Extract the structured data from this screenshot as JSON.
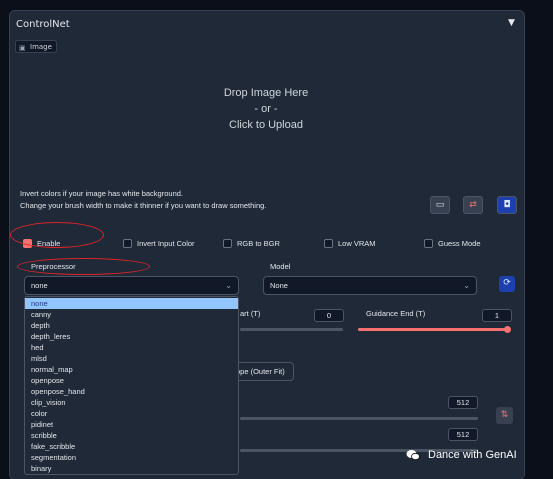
{
  "header": {
    "title": "ControlNet",
    "collapse_icon": "triangle-down-icon"
  },
  "image_tab": {
    "label": "Image",
    "icon": "image-icon"
  },
  "dropzone": {
    "line1": "Drop Image Here",
    "line2": "- or -",
    "line3": "Click to Upload"
  },
  "hints": {
    "line1": "Invert colors if your image has white background.",
    "line2": "Change your brush width to make it thinner if you want to draw something."
  },
  "tools": [
    "canvas-icon",
    "swap-icon",
    "camera-icon"
  ],
  "checkboxes": [
    {
      "label": "Enable",
      "checked": true
    },
    {
      "label": "Invert Input Color",
      "checked": false
    },
    {
      "label": "RGB to BGR",
      "checked": false
    },
    {
      "label": "Low VRAM",
      "checked": false
    },
    {
      "label": "Guess Mode",
      "checked": false
    }
  ],
  "preprocessor": {
    "label": "Preprocessor",
    "value": "none",
    "options": [
      "none",
      "canny",
      "depth",
      "depth_leres",
      "hed",
      "mlsd",
      "normal_map",
      "openpose",
      "openpose_hand",
      "clip_vision",
      "color",
      "pidinet",
      "scribble",
      "fake_scribble",
      "segmentation",
      "binary"
    ]
  },
  "model": {
    "label": "Model",
    "value": "None"
  },
  "guidance_start": {
    "label_partial": "art (T)",
    "value": "0"
  },
  "guidance_end": {
    "label": "Guidance End (T)",
    "value": "1"
  },
  "resize_mode": {
    "visible_label": "ope (Outer Fit)"
  },
  "canvas": {
    "width": "512",
    "height": "512"
  },
  "watermark": {
    "text": "Dance with GenAI"
  },
  "colors": {
    "accent": "#f87171",
    "panel": "#1f2937",
    "background": "#0b0f19",
    "highlight": "#93c5fd"
  }
}
